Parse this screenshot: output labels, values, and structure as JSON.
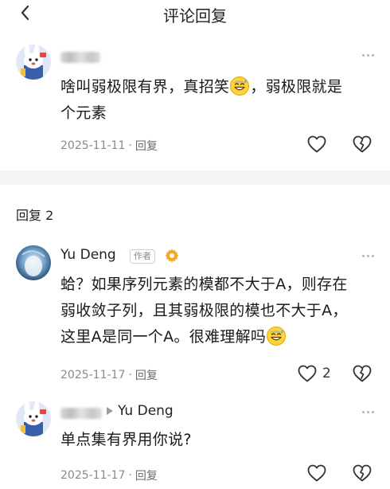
{
  "header": {
    "title": "评论回复"
  },
  "comment": {
    "text_line1_a": "啥叫弱极限有界，真招笑",
    "text_line1_b": "，弱极限就是",
    "text_line2": "个元素",
    "date": "2025-11-11",
    "reply_label": "回复"
  },
  "section": {
    "label": "回复 2"
  },
  "replies": [
    {
      "username": "Yu Deng",
      "badge": "作者",
      "line1": "蛤？如果序列元素的模都不大于A，则存在",
      "line2": "弱收敛子列，且其弱极限的模也不大于A，",
      "line3": "这里A是同一个A。很难理解吗",
      "date": "2025-11-17",
      "reply_label": "回复",
      "like_count": "2"
    },
    {
      "reply_to": "Yu Deng",
      "text": "单点集有界用你说?",
      "date": "2025-11-17",
      "reply_label": "回复"
    }
  ],
  "icons": {
    "back": "chevron-left-icon",
    "more": "more-dots-icon",
    "like": "heart-icon",
    "dislike": "broken-heart-icon",
    "emoji": "sweat-smile-emoji",
    "badge": "gear-badge-icon",
    "arrow": "triangle-right-icon"
  },
  "colors": {
    "accent": "#f5a623",
    "text": "#1a1a1a",
    "meta": "#8a8a8a",
    "divider": "#f4f4f4"
  }
}
